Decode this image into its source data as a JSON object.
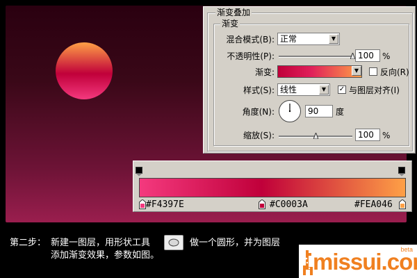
{
  "dialog": {
    "title": "渐变叠加",
    "group_label": "渐变",
    "blend_mode_label": "混合模式(B):",
    "blend_mode_value": "正常",
    "opacity_label": "不透明性(P):",
    "opacity_value": "100",
    "opacity_unit": "%",
    "opacity_fraction": 1.0,
    "gradient_label": "渐变:",
    "reverse_label": "反向(R)",
    "reverse_checked": false,
    "style_label": "样式(S):",
    "style_value": "线性",
    "align_label": "与图层对齐(I)",
    "align_checked": true,
    "align_mark": "✓",
    "angle_label": "角度(N):",
    "angle_value": "90",
    "angle_unit": "度",
    "scale_label": "缩放(S):",
    "scale_value": "100",
    "scale_unit": "%",
    "scale_fraction": 0.5
  },
  "gradient_stops": [
    {
      "label": "#F4397E",
      "color": "#F4397E",
      "position": 0.0
    },
    {
      "label": "#C0003A",
      "color": "#C0003A",
      "position": 0.46
    },
    {
      "label": "#FEA046",
      "color": "#FEA046",
      "position": 1.0
    }
  ],
  "instructions": {
    "step": "第二步：",
    "line1_a": "新建一图层，用形状工具",
    "line1_b": "做一个圆形，并为图层",
    "line2": "添加渐变效果，参数如图。"
  },
  "logo": {
    "text": "missui.com",
    "badge": "beta"
  }
}
